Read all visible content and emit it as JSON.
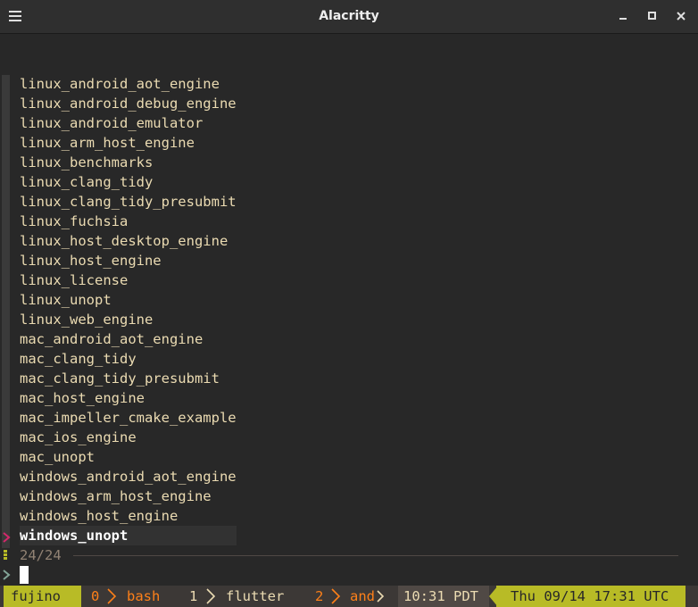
{
  "window": {
    "title": "Alacritty"
  },
  "fzf": {
    "items": [
      "linux_android_aot_engine",
      "linux_android_debug_engine",
      "linux_android_emulator",
      "linux_arm_host_engine",
      "linux_benchmarks",
      "linux_clang_tidy",
      "linux_clang_tidy_presubmit",
      "linux_fuchsia",
      "linux_host_desktop_engine",
      "linux_host_engine",
      "linux_license",
      "linux_unopt",
      "linux_web_engine",
      "mac_android_aot_engine",
      "mac_clang_tidy",
      "mac_clang_tidy_presubmit",
      "mac_host_engine",
      "mac_impeller_cmake_example",
      "mac_ios_engine",
      "mac_unopt",
      "windows_android_aot_engine",
      "windows_arm_host_engine",
      "windows_host_engine",
      "windows_unopt"
    ],
    "selected_index": 23,
    "match_count": "24/24",
    "query": ""
  },
  "tmux": {
    "session": "fujino",
    "windows": [
      {
        "index": "0",
        "name": "bash"
      },
      {
        "index": "1",
        "name": "flutter"
      },
      {
        "index": "2",
        "name": "and"
      }
    ],
    "time": "10:31 PDT",
    "datetime_utc": "Thu 09/14 17:31 UTC"
  },
  "colors": {
    "background": "#282828",
    "foreground": "#ebdbb2",
    "accent_green": "#b8bb26",
    "accent_orange": "#fe8019",
    "pointer_red": "#d3286b",
    "prompt_blue": "#83a598"
  },
  "icons": {
    "menu": "hamburger-icon",
    "minimize": "minimize-icon",
    "maximize": "maximize-icon",
    "close": "close-icon",
    "pointer": "chevron-right-icon",
    "prompt": "chevron-right-icon"
  }
}
